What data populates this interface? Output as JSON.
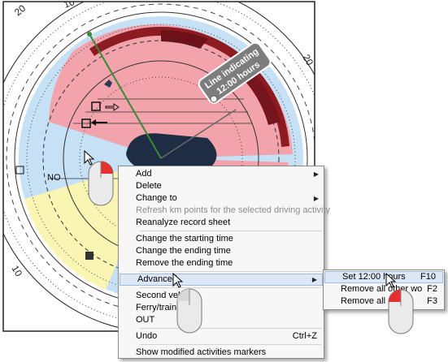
{
  "disc": {
    "callout_line1": "Line indicating",
    "callout_line2": "12:00 hours",
    "scale_labels": [
      "20",
      "10",
      "20",
      "10",
      "20"
    ],
    "area_label_no": "NO"
  },
  "context_menu": {
    "items": [
      {
        "label": "Add",
        "submenu": true
      },
      {
        "label": "Delete"
      },
      {
        "label": "Change to",
        "submenu": true
      },
      {
        "label": "Refresh km points for the selected driving activity",
        "disabled": true
      },
      {
        "label": "Reanalyze record sheet"
      },
      {
        "label": "Change the starting time"
      },
      {
        "label": "Change the ending time"
      },
      {
        "label": "Remove the ending time"
      },
      {
        "label": "Advanced",
        "submenu": true,
        "highlighted": true
      },
      {
        "label": "Second vehicle"
      },
      {
        "label": "Ferry/train"
      },
      {
        "label": "OUT"
      },
      {
        "label": "Undo",
        "shortcut": "Ctrl+Z"
      },
      {
        "label": "Show modified activities markers"
      }
    ]
  },
  "submenu": {
    "items": [
      {
        "label": "Set 12:00 hours",
        "shortcut": "F10",
        "highlighted": true
      },
      {
        "label": "Remove all other wo",
        "shortcut": "F2"
      },
      {
        "label": "Remove all availa",
        "shortcut": "F3"
      }
    ]
  },
  "colors": {
    "highlight": "#dde8f7",
    "activity_red": "#f0a0a8",
    "dark_red": "#8c1b22",
    "rest_blue": "#c6e0f5",
    "yellow": "#faf5b2"
  }
}
